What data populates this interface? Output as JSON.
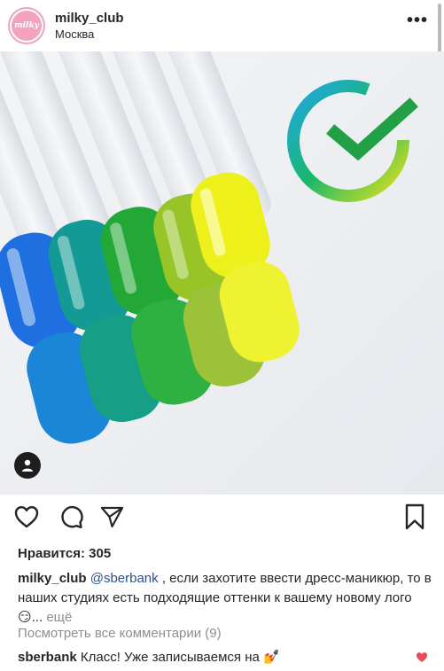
{
  "post": {
    "username": "milky_club",
    "location": "Москва",
    "avatar_text": "milky",
    "more_label": "•••"
  },
  "photo": {
    "description_icon": "sber-logo",
    "polish_colors": [
      "#1f72d8",
      "#13908c",
      "#26a83c",
      "#95c22c",
      "#eef021"
    ]
  },
  "actions": {
    "like_icon": "heart-icon",
    "comment_icon": "comment-icon",
    "share_icon": "send-icon",
    "save_icon": "bookmark-icon"
  },
  "likes": {
    "label": "Нравится: 305"
  },
  "caption": {
    "user": "milky_club",
    "mention": "@sberbank",
    "text": " , если захотите ввести дресс-маникюр, то в наших студиях есть подходящие оттенки к вашему новому лого 😏... ",
    "more": "ещё"
  },
  "comments": {
    "view_all": "Посмотреть все комментарии (9)",
    "first": {
      "user": "sberbank",
      "text": " Класс! Уже записываемся на 💅"
    }
  },
  "colors": {
    "heart_red": "#ed4956",
    "link_blue": "#2b4f8a",
    "muted": "#8e8e8e"
  }
}
